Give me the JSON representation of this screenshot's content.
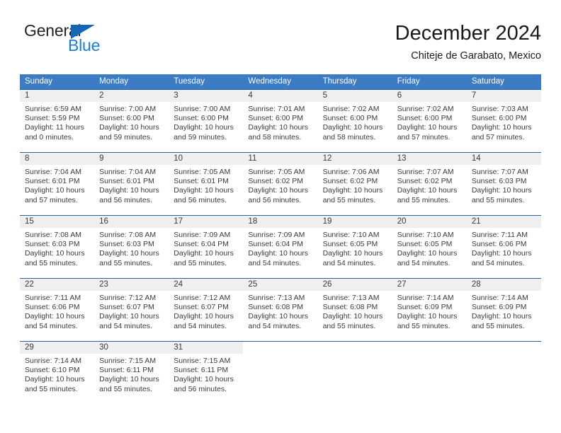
{
  "brand": {
    "name_part1": "General",
    "name_part2": "Blue",
    "flag_icon": "triangle-flag-icon"
  },
  "header": {
    "title": "December 2024",
    "subtitle": "Chiteje de Garabato, Mexico"
  },
  "colors": {
    "header_blue": "#3b7cc4",
    "separator_blue": "#2a62a8",
    "daynum_band": "#efefef",
    "brand_blue": "#1a7fd4",
    "text": "#3a3a3a"
  },
  "weekdays": [
    "Sunday",
    "Monday",
    "Tuesday",
    "Wednesday",
    "Thursday",
    "Friday",
    "Saturday"
  ],
  "weeks": [
    {
      "days": [
        {
          "num": "1",
          "sunrise": "Sunrise: 6:59 AM",
          "sunset": "Sunset: 5:59 PM",
          "daylight1": "Daylight: 11 hours",
          "daylight2": "and 0 minutes."
        },
        {
          "num": "2",
          "sunrise": "Sunrise: 7:00 AM",
          "sunset": "Sunset: 6:00 PM",
          "daylight1": "Daylight: 10 hours",
          "daylight2": "and 59 minutes."
        },
        {
          "num": "3",
          "sunrise": "Sunrise: 7:00 AM",
          "sunset": "Sunset: 6:00 PM",
          "daylight1": "Daylight: 10 hours",
          "daylight2": "and 59 minutes."
        },
        {
          "num": "4",
          "sunrise": "Sunrise: 7:01 AM",
          "sunset": "Sunset: 6:00 PM",
          "daylight1": "Daylight: 10 hours",
          "daylight2": "and 58 minutes."
        },
        {
          "num": "5",
          "sunrise": "Sunrise: 7:02 AM",
          "sunset": "Sunset: 6:00 PM",
          "daylight1": "Daylight: 10 hours",
          "daylight2": "and 58 minutes."
        },
        {
          "num": "6",
          "sunrise": "Sunrise: 7:02 AM",
          "sunset": "Sunset: 6:00 PM",
          "daylight1": "Daylight: 10 hours",
          "daylight2": "and 57 minutes."
        },
        {
          "num": "7",
          "sunrise": "Sunrise: 7:03 AM",
          "sunset": "Sunset: 6:00 PM",
          "daylight1": "Daylight: 10 hours",
          "daylight2": "and 57 minutes."
        }
      ]
    },
    {
      "days": [
        {
          "num": "8",
          "sunrise": "Sunrise: 7:04 AM",
          "sunset": "Sunset: 6:01 PM",
          "daylight1": "Daylight: 10 hours",
          "daylight2": "and 57 minutes."
        },
        {
          "num": "9",
          "sunrise": "Sunrise: 7:04 AM",
          "sunset": "Sunset: 6:01 PM",
          "daylight1": "Daylight: 10 hours",
          "daylight2": "and 56 minutes."
        },
        {
          "num": "10",
          "sunrise": "Sunrise: 7:05 AM",
          "sunset": "Sunset: 6:01 PM",
          "daylight1": "Daylight: 10 hours",
          "daylight2": "and 56 minutes."
        },
        {
          "num": "11",
          "sunrise": "Sunrise: 7:05 AM",
          "sunset": "Sunset: 6:02 PM",
          "daylight1": "Daylight: 10 hours",
          "daylight2": "and 56 minutes."
        },
        {
          "num": "12",
          "sunrise": "Sunrise: 7:06 AM",
          "sunset": "Sunset: 6:02 PM",
          "daylight1": "Daylight: 10 hours",
          "daylight2": "and 55 minutes."
        },
        {
          "num": "13",
          "sunrise": "Sunrise: 7:07 AM",
          "sunset": "Sunset: 6:02 PM",
          "daylight1": "Daylight: 10 hours",
          "daylight2": "and 55 minutes."
        },
        {
          "num": "14",
          "sunrise": "Sunrise: 7:07 AM",
          "sunset": "Sunset: 6:03 PM",
          "daylight1": "Daylight: 10 hours",
          "daylight2": "and 55 minutes."
        }
      ]
    },
    {
      "days": [
        {
          "num": "15",
          "sunrise": "Sunrise: 7:08 AM",
          "sunset": "Sunset: 6:03 PM",
          "daylight1": "Daylight: 10 hours",
          "daylight2": "and 55 minutes."
        },
        {
          "num": "16",
          "sunrise": "Sunrise: 7:08 AM",
          "sunset": "Sunset: 6:03 PM",
          "daylight1": "Daylight: 10 hours",
          "daylight2": "and 55 minutes."
        },
        {
          "num": "17",
          "sunrise": "Sunrise: 7:09 AM",
          "sunset": "Sunset: 6:04 PM",
          "daylight1": "Daylight: 10 hours",
          "daylight2": "and 55 minutes."
        },
        {
          "num": "18",
          "sunrise": "Sunrise: 7:09 AM",
          "sunset": "Sunset: 6:04 PM",
          "daylight1": "Daylight: 10 hours",
          "daylight2": "and 54 minutes."
        },
        {
          "num": "19",
          "sunrise": "Sunrise: 7:10 AM",
          "sunset": "Sunset: 6:05 PM",
          "daylight1": "Daylight: 10 hours",
          "daylight2": "and 54 minutes."
        },
        {
          "num": "20",
          "sunrise": "Sunrise: 7:10 AM",
          "sunset": "Sunset: 6:05 PM",
          "daylight1": "Daylight: 10 hours",
          "daylight2": "and 54 minutes."
        },
        {
          "num": "21",
          "sunrise": "Sunrise: 7:11 AM",
          "sunset": "Sunset: 6:06 PM",
          "daylight1": "Daylight: 10 hours",
          "daylight2": "and 54 minutes."
        }
      ]
    },
    {
      "days": [
        {
          "num": "22",
          "sunrise": "Sunrise: 7:11 AM",
          "sunset": "Sunset: 6:06 PM",
          "daylight1": "Daylight: 10 hours",
          "daylight2": "and 54 minutes."
        },
        {
          "num": "23",
          "sunrise": "Sunrise: 7:12 AM",
          "sunset": "Sunset: 6:07 PM",
          "daylight1": "Daylight: 10 hours",
          "daylight2": "and 54 minutes."
        },
        {
          "num": "24",
          "sunrise": "Sunrise: 7:12 AM",
          "sunset": "Sunset: 6:07 PM",
          "daylight1": "Daylight: 10 hours",
          "daylight2": "and 54 minutes."
        },
        {
          "num": "25",
          "sunrise": "Sunrise: 7:13 AM",
          "sunset": "Sunset: 6:08 PM",
          "daylight1": "Daylight: 10 hours",
          "daylight2": "and 54 minutes."
        },
        {
          "num": "26",
          "sunrise": "Sunrise: 7:13 AM",
          "sunset": "Sunset: 6:08 PM",
          "daylight1": "Daylight: 10 hours",
          "daylight2": "and 55 minutes."
        },
        {
          "num": "27",
          "sunrise": "Sunrise: 7:14 AM",
          "sunset": "Sunset: 6:09 PM",
          "daylight1": "Daylight: 10 hours",
          "daylight2": "and 55 minutes."
        },
        {
          "num": "28",
          "sunrise": "Sunrise: 7:14 AM",
          "sunset": "Sunset: 6:09 PM",
          "daylight1": "Daylight: 10 hours",
          "daylight2": "and 55 minutes."
        }
      ]
    },
    {
      "days": [
        {
          "num": "29",
          "sunrise": "Sunrise: 7:14 AM",
          "sunset": "Sunset: 6:10 PM",
          "daylight1": "Daylight: 10 hours",
          "daylight2": "and 55 minutes."
        },
        {
          "num": "30",
          "sunrise": "Sunrise: 7:15 AM",
          "sunset": "Sunset: 6:11 PM",
          "daylight1": "Daylight: 10 hours",
          "daylight2": "and 55 minutes."
        },
        {
          "num": "31",
          "sunrise": "Sunrise: 7:15 AM",
          "sunset": "Sunset: 6:11 PM",
          "daylight1": "Daylight: 10 hours",
          "daylight2": "and 56 minutes."
        },
        {
          "num": "",
          "sunrise": "",
          "sunset": "",
          "daylight1": "",
          "daylight2": ""
        },
        {
          "num": "",
          "sunrise": "",
          "sunset": "",
          "daylight1": "",
          "daylight2": ""
        },
        {
          "num": "",
          "sunrise": "",
          "sunset": "",
          "daylight1": "",
          "daylight2": ""
        },
        {
          "num": "",
          "sunrise": "",
          "sunset": "",
          "daylight1": "",
          "daylight2": ""
        }
      ]
    }
  ]
}
